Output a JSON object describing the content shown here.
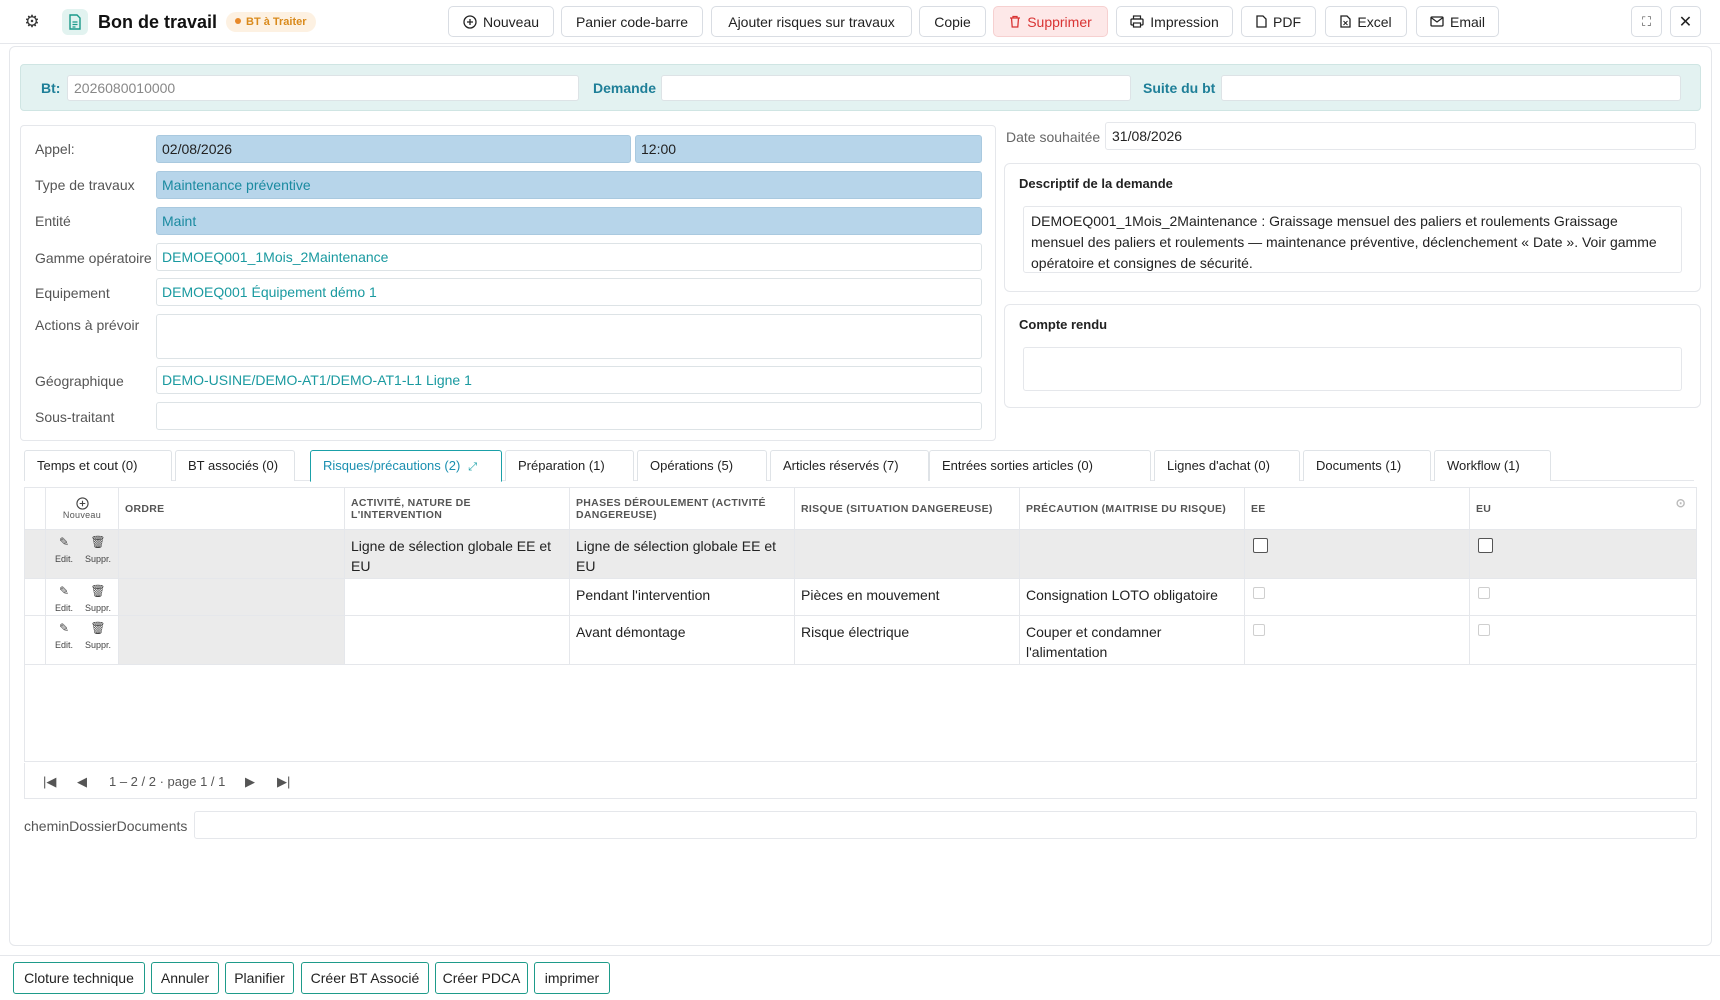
{
  "header": {
    "title": "Bon de travail",
    "status_badge": "BT à Traiter",
    "buttons": {
      "nouveau": "Nouveau",
      "panier": "Panier code-barre",
      "ajouter_risques": "Ajouter risques sur travaux",
      "copie": "Copie",
      "supprimer": "Supprimer",
      "impression": "Impression",
      "pdf": "PDF",
      "excel": "Excel",
      "email": "Email"
    }
  },
  "top_fields": {
    "bt_label": "Bt:",
    "bt_value": "2026080010000",
    "demande_label": "Demande",
    "demande_value": "",
    "suite_label": "Suite du bt",
    "suite_value": ""
  },
  "form": {
    "appel_label": "Appel:",
    "appel_date": "02/08/2026",
    "appel_time": "12:00",
    "type_label": "Type de travaux",
    "type_value": "Maintenance préventive",
    "entite_label": "Entité",
    "entite_value": "Maint",
    "gamme_label": "Gamme opératoire",
    "gamme_value": "DEMOEQ001_1Mois_2Maintenance",
    "equipement_label": "Equipement",
    "equipement_value": "DEMOEQ001 Équipement démo 1",
    "actions_label": "Actions à prévoir",
    "actions_value": "",
    "geo_label": "Géographique",
    "geo_value": "DEMO-USINE/DEMO-AT1/DEMO-AT1-L1 Ligne 1",
    "sous_label": "Sous-traitant",
    "sous_value": ""
  },
  "right": {
    "date_souhaitee_label": "Date souhaitée",
    "date_souhaitee_value": "31/08/2026",
    "descriptif_title": "Descriptif de la demande",
    "descriptif_text": "DEMOEQ001_1Mois_2Maintenance : Graissage mensuel des paliers et roulements Graissage mensuel des paliers et roulements — maintenance préventive, déclenchement « Date ». Voir gamme opératoire et consignes de sécurité.",
    "compte_rendu_title": "Compte rendu",
    "compte_rendu_text": ""
  },
  "tabs": [
    {
      "label": "Temps et cout (0)"
    },
    {
      "label": "BT associés (0)"
    },
    {
      "label": "Risques/précautions (2)"
    },
    {
      "label": "Préparation (1)"
    },
    {
      "label": "Opérations (5)"
    },
    {
      "label": "Articles réservés (7)"
    },
    {
      "label": "Entrées sorties articles (0)"
    },
    {
      "label": "Lignes d'achat (0)"
    },
    {
      "label": "Documents (1)"
    },
    {
      "label": "Workflow (1)"
    }
  ],
  "grid": {
    "new_label": "Nouveau",
    "edit_label": "Edit.",
    "delete_label": "Suppr.",
    "columns": {
      "ordre": "Ordre",
      "activite": "Activité, nature de l'intervention",
      "phases": "Phases déroulement (activité dangereuse)",
      "risque": "Risque (situation dangereuse)",
      "precaution": "Précaution (maitrise du risque)",
      "ee": "EE",
      "eu": "EU"
    },
    "rows": [
      {
        "ordre": "",
        "activite": "Ligne de sélection globale EE et EU",
        "phases": "Ligne de sélection globale EE et EU",
        "risque": "",
        "precaution": ""
      },
      {
        "ordre": "",
        "activite": "",
        "phases": "Pendant l'intervention",
        "risque": "Pièces en mouvement",
        "precaution": "Consignation LOTO obligatoire"
      },
      {
        "ordre": "",
        "activite": "",
        "phases": "Avant démontage",
        "risque": "Risque électrique",
        "precaution": "Couper et condamner l'alimentation"
      }
    ],
    "pager_text": "1 – 2 / 2 · page 1 / 1"
  },
  "chemin": {
    "label": "cheminDossierDocuments",
    "value": ""
  },
  "bottom_buttons": {
    "cloture": "Cloture technique",
    "annuler": "Annuler",
    "planifier": "Planifier",
    "creer_bt": "Créer BT Associé",
    "creer_pdca": "Créer PDCA",
    "imprimer": "imprimer"
  }
}
